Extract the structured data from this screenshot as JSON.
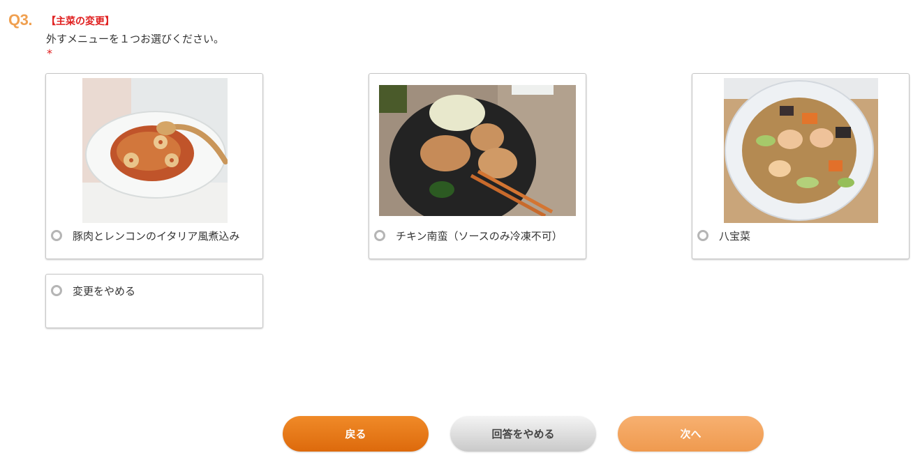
{
  "question": {
    "number": "Q3.",
    "category": "【主菜の変更】",
    "text": "外すメニューを１つお選びください。",
    "required_mark": "*"
  },
  "options": [
    {
      "label": "豚肉とレンコンのイタリア風煮込み",
      "selected": false
    },
    {
      "label": "チキン南蛮（ソースのみ冷凍不可）",
      "selected": false
    },
    {
      "label": "八宝菜",
      "selected": false
    },
    {
      "label": "変更をやめる",
      "selected": false
    }
  ],
  "buttons": {
    "back": "戻る",
    "quit": "回答をやめる",
    "next": "次へ"
  },
  "colors": {
    "accent_orange": "#dd6a0c",
    "question_number": "#f0a050",
    "required_red": "#e02020"
  }
}
